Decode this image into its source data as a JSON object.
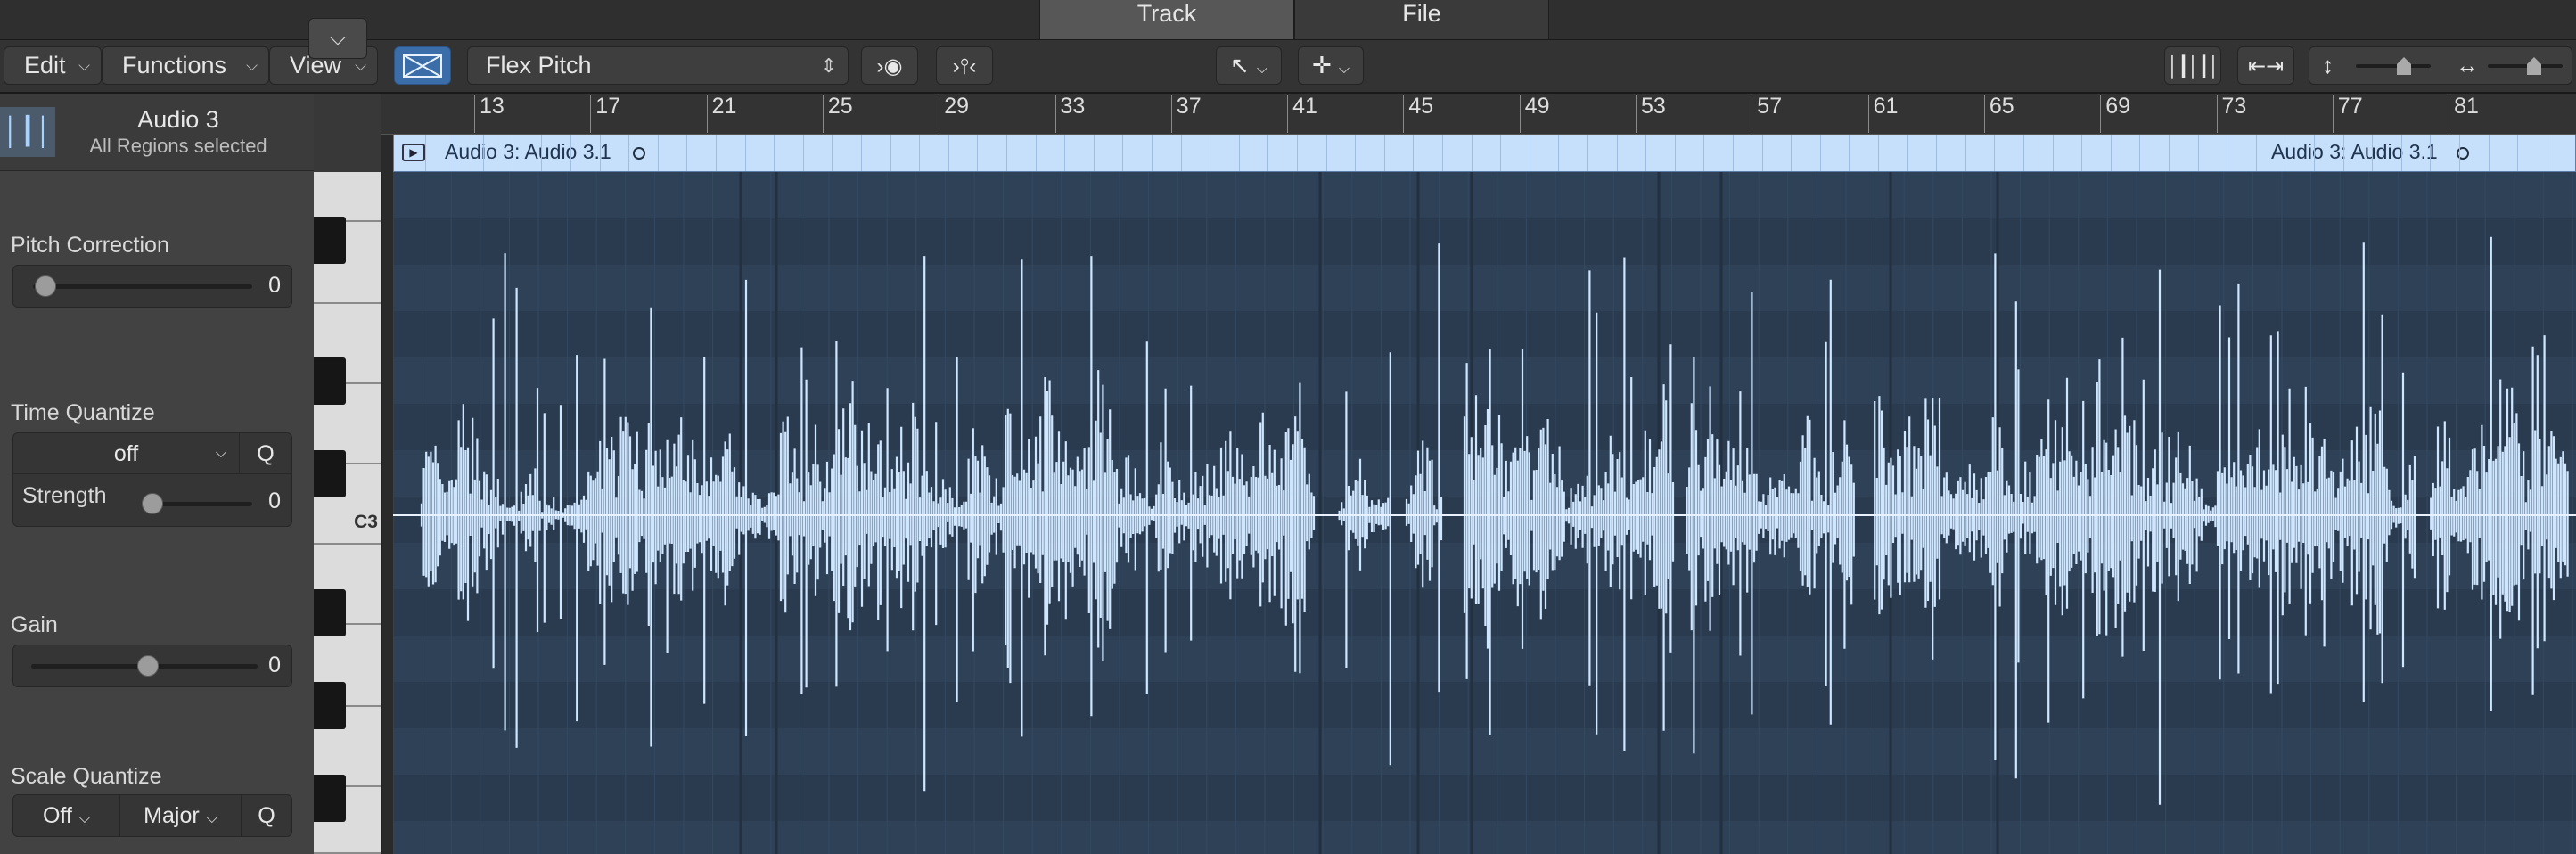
{
  "tabs": {
    "track": "Track",
    "file": "File"
  },
  "toolbar": {
    "edit_label": "Edit",
    "functions_label": "Functions",
    "view_label": "View",
    "mode_label": "Flex Pitch"
  },
  "track": {
    "name": "Audio 3",
    "subtitle": "All Regions selected"
  },
  "inspector": {
    "pitch_correction": {
      "label": "Pitch Correction",
      "value": "0",
      "level": 0.0
    },
    "time_quantize": {
      "label": "Time Quantize",
      "value": "off",
      "q_label": "Q"
    },
    "strength": {
      "label": "Strength",
      "value": "0",
      "level": 0.0
    },
    "gain": {
      "label": "Gain",
      "value": "0",
      "level": 0.5
    },
    "scale_quantize": {
      "label": "Scale Quantize",
      "value": "Off",
      "scale": "Major",
      "q_label": "Q"
    }
  },
  "keyboard": {
    "c3_label": "C3"
  },
  "ruler": {
    "bars": [
      "13",
      "17",
      "21",
      "25",
      "29",
      "33",
      "37",
      "41",
      "45",
      "49",
      "53",
      "57",
      "61",
      "65",
      "69",
      "73",
      "77",
      "81"
    ]
  },
  "region": {
    "name_start": "Audio 3: Audio 3.1",
    "name_end": "Audio 3: Audio 3.1"
  },
  "colors": {
    "waveform": "#cfe6ff",
    "region": "#c6dffa",
    "editor_bg": "#2b3c50",
    "accent": "#3b6ea8"
  },
  "icons": {
    "track_type": "waveform-icon",
    "catch": "link-icon",
    "mode_stepper": "up-down-stepper-icon",
    "palette": "palette-icon",
    "filter": "filter-icon",
    "pointer": "pointer-tool-icon",
    "marquee": "crosshair-tool-icon",
    "wave_zoom": "waveform-zoom-icon",
    "fit": "fit-horizontal-icon",
    "vzoom": "vertical-zoom-icon",
    "hzoom": "horizontal-zoom-icon"
  }
}
